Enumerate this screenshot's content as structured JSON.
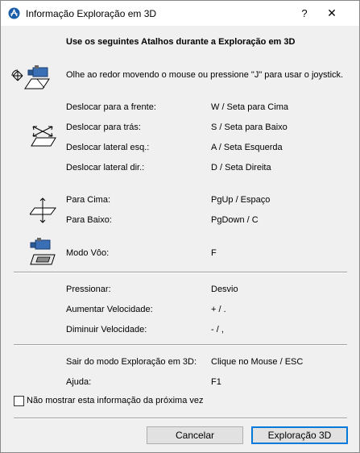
{
  "window": {
    "title": "Informação Exploração em 3D",
    "help_glyph": "?",
    "close_glyph": "✕"
  },
  "heading": "Use os seguintes Atalhos durante a Exploração em 3D",
  "intro": "Olhe ao redor movendo o mouse ou pressione \"J\" para usar o joystick.",
  "movement": [
    {
      "label": "Deslocar para a frente:",
      "value": "W / Seta para Cima"
    },
    {
      "label": "Deslocar para trás:",
      "value": "S / Seta para Baixo"
    },
    {
      "label": "Deslocar lateral esq.:",
      "value": "A / Seta Esquerda"
    },
    {
      "label": "Deslocar lateral dir.:",
      "value": "D / Seta Direita"
    }
  ],
  "vertical": [
    {
      "label": "Para Cima:",
      "value": "PgUp / Espaço"
    },
    {
      "label": "Para Baixo:",
      "value": "PgDown / C"
    }
  ],
  "fly": {
    "label": "Modo Vôo:",
    "value": "F"
  },
  "speed": [
    {
      "label": "Pressionar:",
      "value": "Desvio"
    },
    {
      "label": "Aumentar Velocidade:",
      "value": "+ / ."
    },
    {
      "label": "Diminuir Velocidade:",
      "value": "- / ,"
    }
  ],
  "exit": [
    {
      "label": "Sair do modo Exploração em 3D:",
      "value": "Clique no Mouse / ESC"
    },
    {
      "label": "Ajuda:",
      "value": "F1"
    }
  ],
  "checkbox_label": "Não mostrar esta informação da próxima vez",
  "buttons": {
    "cancel": "Cancelar",
    "confirm": "Exploração 3D"
  },
  "colors": {
    "accent": "#0078d7",
    "window_bg": "#f0f0f0",
    "icon_blue": "#1a5ea8"
  },
  "icons": {
    "app": "archicad-app-icon",
    "look_around": "camera-look-around-icon",
    "move": "move-arrows-icon",
    "vertical": "up-down-arrows-icon",
    "fly": "fly-mode-camera-icon"
  }
}
